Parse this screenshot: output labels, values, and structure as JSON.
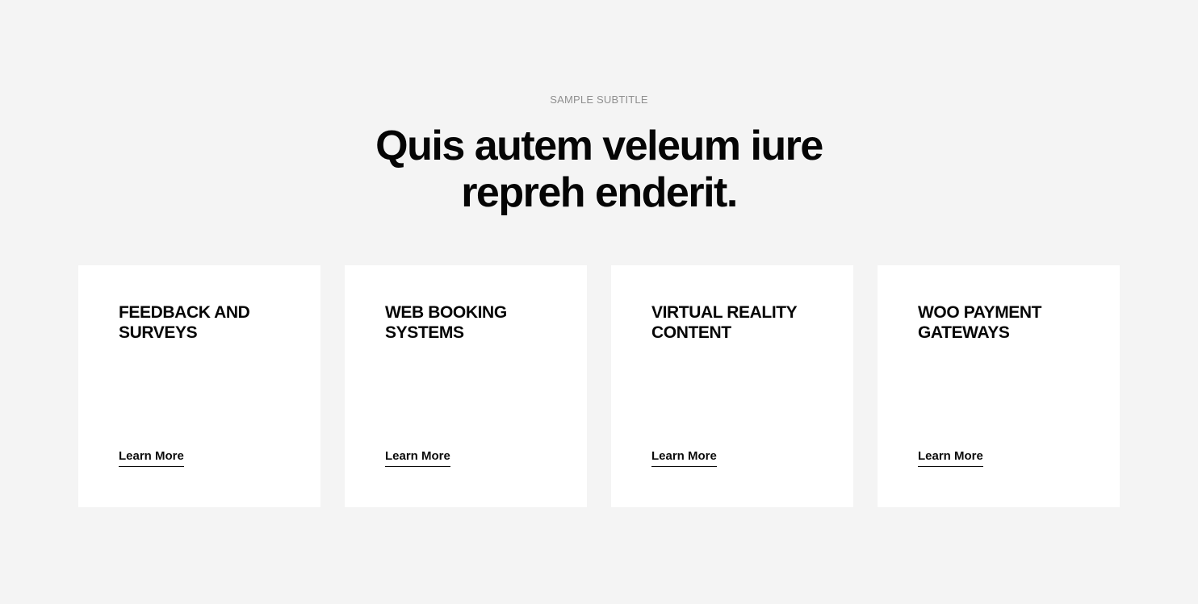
{
  "section": {
    "subtitle": "SAMPLE SUBTITLE",
    "heading_line1": "Quis autem veleum iure",
    "heading_line2": "repreh enderit."
  },
  "cards": [
    {
      "title_line1": "FEEDBACK AND",
      "title_line2": "SURVEYS",
      "link_label": "Learn More"
    },
    {
      "title_line1": "WEB BOOKING",
      "title_line2": "SYSTEMS",
      "link_label": "Learn More"
    },
    {
      "title_line1": "VIRTUAL REALITY",
      "title_line2": "CONTENT",
      "link_label": "Learn More"
    },
    {
      "title_line1": "WOO PAYMENT",
      "title_line2": "GATEWAYS",
      "link_label": "Learn More"
    }
  ],
  "colors": {
    "background": "#f4f4f4",
    "card": "#ffffff",
    "text": "#050505",
    "subtitle": "#8f8f8f"
  }
}
